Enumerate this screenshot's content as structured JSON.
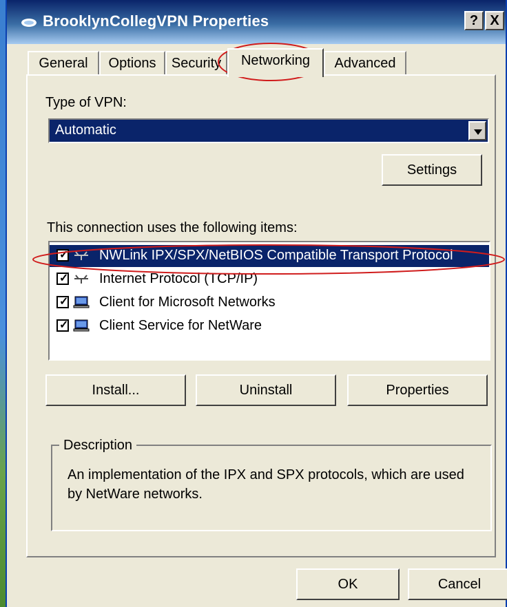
{
  "window": {
    "title": "BrooklynCollegVPN Properties",
    "help_label": "?",
    "close_label": "X"
  },
  "tabs": [
    {
      "label": "General"
    },
    {
      "label": "Options"
    },
    {
      "label": "Security"
    },
    {
      "label": "Networking"
    },
    {
      "label": "Advanced"
    }
  ],
  "vpn": {
    "type_label": "Type of VPN:",
    "selected": "Automatic",
    "settings_label": "Settings"
  },
  "items": {
    "header": "This connection uses the following items:",
    "list": [
      {
        "label": "NWLink IPX/SPX/NetBIOS Compatible Transport Protocol",
        "checked": true,
        "icon": "protocol-icon"
      },
      {
        "label": "Internet Protocol (TCP/IP)",
        "checked": true,
        "icon": "protocol-icon"
      },
      {
        "label": "Client for Microsoft Networks",
        "checked": true,
        "icon": "computer-icon"
      },
      {
        "label": "Client Service for NetWare",
        "checked": true,
        "icon": "computer-icon"
      }
    ]
  },
  "buttons": {
    "install": "Install...",
    "uninstall": "Uninstall",
    "properties": "Properties",
    "ok": "OK",
    "cancel": "Cancel"
  },
  "description": {
    "title": "Description",
    "text": "An implementation of the IPX and SPX protocols, which are used by NetWare networks."
  },
  "colors": {
    "selection": "#0a246a",
    "annotation": "#d01c1c"
  }
}
